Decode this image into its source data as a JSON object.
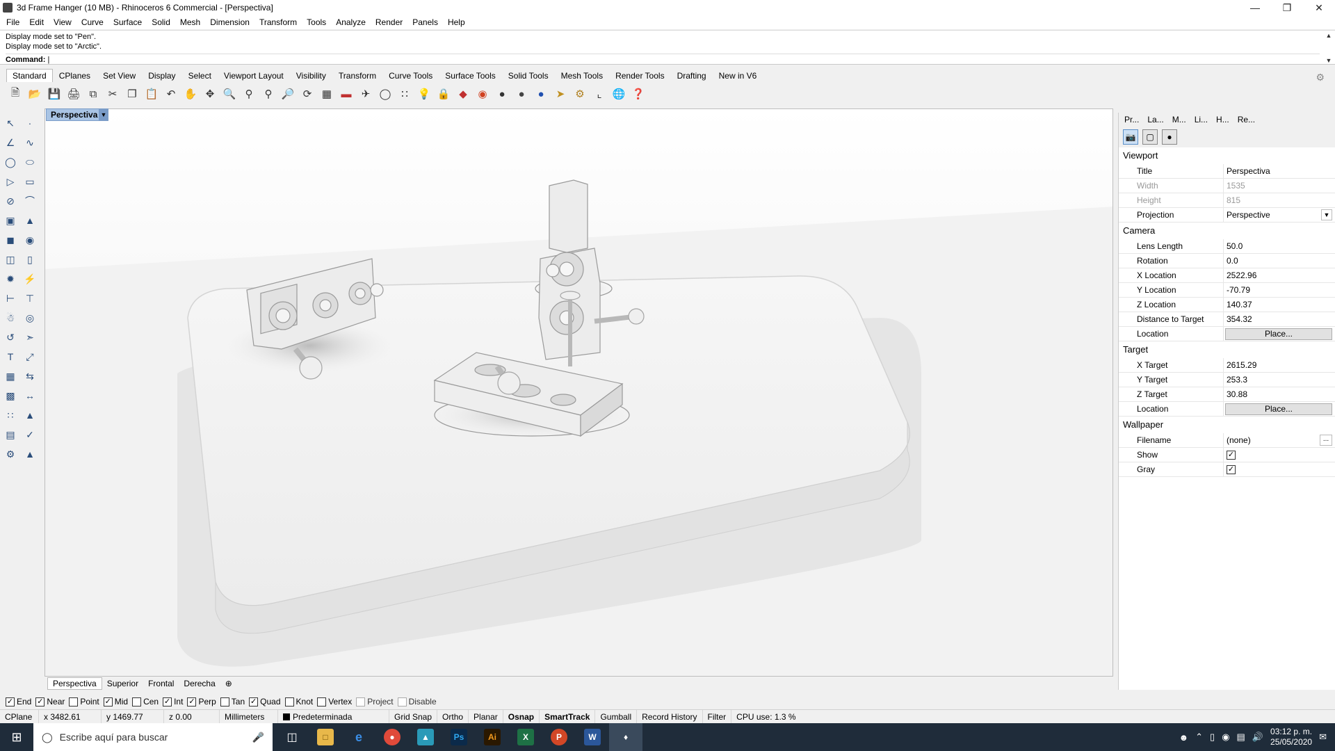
{
  "window": {
    "title": "3d Frame Hanger (10 MB) - Rhinoceros 6 Commercial - [Perspectiva]"
  },
  "menu": [
    "File",
    "Edit",
    "View",
    "Curve",
    "Surface",
    "Solid",
    "Mesh",
    "Dimension",
    "Transform",
    "Tools",
    "Analyze",
    "Render",
    "Panels",
    "Help"
  ],
  "command": {
    "history": [
      "Display mode set to \"Pen\".",
      "Display mode set to \"Arctic\"."
    ],
    "prompt": "Command:"
  },
  "toolbar_tabs": [
    "Standard",
    "CPlanes",
    "Set View",
    "Display",
    "Select",
    "Viewport Layout",
    "Visibility",
    "Transform",
    "Curve Tools",
    "Surface Tools",
    "Solid Tools",
    "Mesh Tools",
    "Render Tools",
    "Drafting",
    "New in V6"
  ],
  "toolbar_icons": [
    "new-icon",
    "open-icon",
    "save-icon",
    "print-icon",
    "import-icon",
    "cut-icon",
    "copy-icon",
    "paste-icon",
    "undo-icon",
    "pan-hand-icon",
    "pan-icon",
    "zoom-icon",
    "zoom-window-icon",
    "zoom-extents-icon",
    "zoom-selected-icon",
    "rotate-view-icon",
    "grid-icon",
    "car-render-icon",
    "plane-icon",
    "circle-icon",
    "points-icon",
    "light-icon",
    "lock-icon",
    "material-icon",
    "color-wheel-icon",
    "sphere-shaded-icon",
    "sphere-render-icon",
    "sphere-blue-icon",
    "filter-icon",
    "gear-icon",
    "dimension-icon",
    "globe-icon",
    "help-icon"
  ],
  "viewport": {
    "active_label": "Perspectiva",
    "tabs": [
      "Perspectiva",
      "Superior",
      "Frontal",
      "Derecha"
    ]
  },
  "panel": {
    "tabs": [
      "Pr...",
      "La...",
      "M...",
      "Li...",
      "H...",
      "Re..."
    ],
    "sections": {
      "viewport": {
        "heading": "Viewport",
        "title_label": "Title",
        "title_value": "Perspectiva",
        "width_label": "Width",
        "width_value": "1535",
        "height_label": "Height",
        "height_value": "815",
        "projection_label": "Projection",
        "projection_value": "Perspective"
      },
      "camera": {
        "heading": "Camera",
        "lens_label": "Lens Length",
        "lens_value": "50.0",
        "rotation_label": "Rotation",
        "rotation_value": "0.0",
        "xloc_label": "X Location",
        "xloc_value": "2522.96",
        "yloc_label": "Y Location",
        "yloc_value": "-70.79",
        "zloc_label": "Z Location",
        "zloc_value": "140.37",
        "dist_label": "Distance to Target",
        "dist_value": "354.32",
        "location_label": "Location",
        "location_button": "Place..."
      },
      "target": {
        "heading": "Target",
        "x_label": "X Target",
        "x_value": "2615.29",
        "y_label": "Y Target",
        "y_value": "253.3",
        "z_label": "Z Target",
        "z_value": "30.88",
        "location_label": "Location",
        "location_button": "Place..."
      },
      "wallpaper": {
        "heading": "Wallpaper",
        "filename_label": "Filename",
        "filename_value": "(none)",
        "show_label": "Show",
        "show_checked": true,
        "gray_label": "Gray",
        "gray_checked": true
      }
    }
  },
  "osnap": [
    {
      "label": "End",
      "checked": true
    },
    {
      "label": "Near",
      "checked": true
    },
    {
      "label": "Point",
      "checked": false
    },
    {
      "label": "Mid",
      "checked": true
    },
    {
      "label": "Cen",
      "checked": false
    },
    {
      "label": "Int",
      "checked": true
    },
    {
      "label": "Perp",
      "checked": true
    },
    {
      "label": "Tan",
      "checked": false
    },
    {
      "label": "Quad",
      "checked": true
    },
    {
      "label": "Knot",
      "checked": false
    },
    {
      "label": "Vertex",
      "checked": false
    },
    {
      "label": "Project",
      "checked": false
    },
    {
      "label": "Disable",
      "checked": false
    }
  ],
  "status": {
    "cplane": "CPlane",
    "x": "x 3482.61",
    "y": "y 1469.77",
    "z": "z 0.00",
    "units": "Millimeters",
    "layer": "Predeterminada",
    "toggles": [
      "Grid Snap",
      "Ortho",
      "Planar",
      "Osnap",
      "SmartTrack",
      "Gumball",
      "Record History",
      "Filter"
    ],
    "bold_toggles": [
      "Osnap",
      "SmartTrack"
    ],
    "cpu": "CPU use: 1.3 %"
  },
  "taskbar": {
    "search_placeholder": "Escribe aquí para buscar",
    "time": "03:12 p. m.",
    "date": "25/05/2020"
  }
}
